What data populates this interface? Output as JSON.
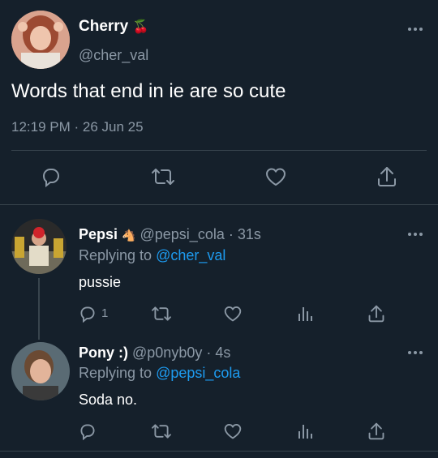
{
  "main_tweet": {
    "name": "Cherry",
    "name_emoji": "🍒",
    "handle": "@cher_val",
    "text": "Words that end in ie are so cute",
    "meta": "12:19 PM · 26 Jun 25"
  },
  "replies": [
    {
      "name": "Pepsi",
      "name_emoji": "🐴",
      "handle": "@pepsi_cola",
      "time": "· 31s",
      "replying_prefix": "Replying to",
      "replying_to": "@cher_val",
      "text": "pussie",
      "reply_count": "1"
    },
    {
      "name": "Pony :)",
      "handle": "@p0nyb0y",
      "time": "· 4s",
      "replying_prefix": "Replying to",
      "replying_to": "@pepsi_cola",
      "text": "Soda no."
    }
  ],
  "colors": {
    "background": "#15202b",
    "muted": "#8b98a5",
    "link": "#1d9bf0",
    "divider": "#38444d"
  }
}
